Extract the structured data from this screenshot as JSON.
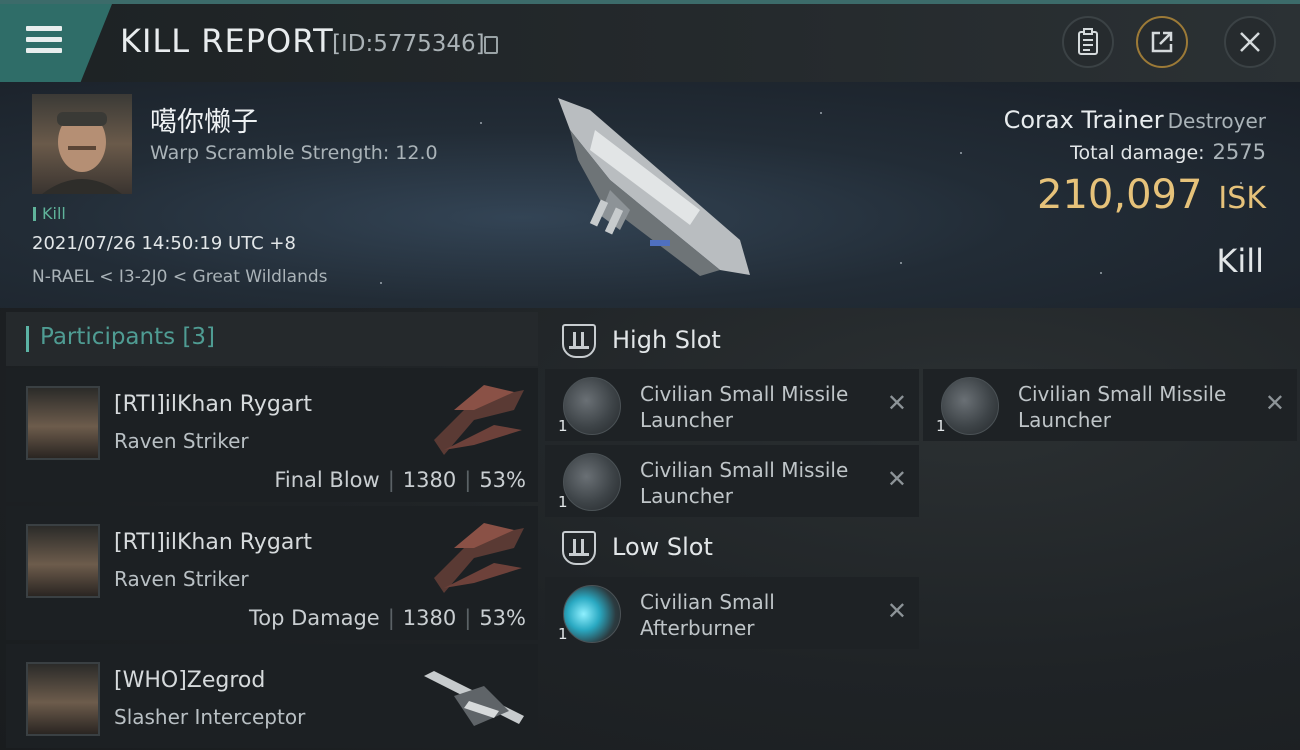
{
  "header": {
    "title": "KILL REPORT",
    "report_id": "[ID:5775346]",
    "icons": [
      "menu-icon",
      "copy-icon",
      "clipboard-icon",
      "share-icon",
      "close-icon"
    ]
  },
  "victim": {
    "name": "噶你懒子",
    "warp_scramble": "Warp Scramble Strength: 12.0",
    "tag": "Kill",
    "datetime": "2021/07/26 14:50:19 UTC +8",
    "location": "N-RAEL < I3-2J0 < Great Wildlands"
  },
  "ship": {
    "name": "Corax Trainer",
    "class": "Destroyer",
    "total_damage_label": "Total damage:",
    "total_damage": "2575",
    "isk_value": "210,097",
    "isk_unit": "ISK",
    "result": "Kill"
  },
  "participants": {
    "header": "Participants [3]",
    "list": [
      {
        "name": "[RTI]ilKhan Rygart",
        "ship": "Raven Striker",
        "role": "Final Blow",
        "damage": "1380",
        "percent": "53%"
      },
      {
        "name": "[RTI]ilKhan Rygart",
        "ship": "Raven Striker",
        "role": "Top Damage",
        "damage": "1380",
        "percent": "53%"
      },
      {
        "name": "[WHO]Zegrod",
        "ship": "Slasher Interceptor",
        "role": "",
        "damage": "",
        "percent": ""
      }
    ]
  },
  "fitting": {
    "high_slot_label": "High Slot",
    "low_slot_label": "Low Slot",
    "high": [
      {
        "qty": "1",
        "line1": "Civilian Small Missile",
        "line2": "Launcher"
      },
      {
        "qty": "1",
        "line1": "Civilian Small Missile",
        "line2": "Launcher"
      },
      {
        "qty": "1",
        "line1": "Civilian Small Missile",
        "line2": "Launcher"
      }
    ],
    "low": [
      {
        "qty": "1",
        "line1": "Civilian Small",
        "line2": "Afterburner"
      }
    ],
    "destroyed_marker": "✕"
  }
}
